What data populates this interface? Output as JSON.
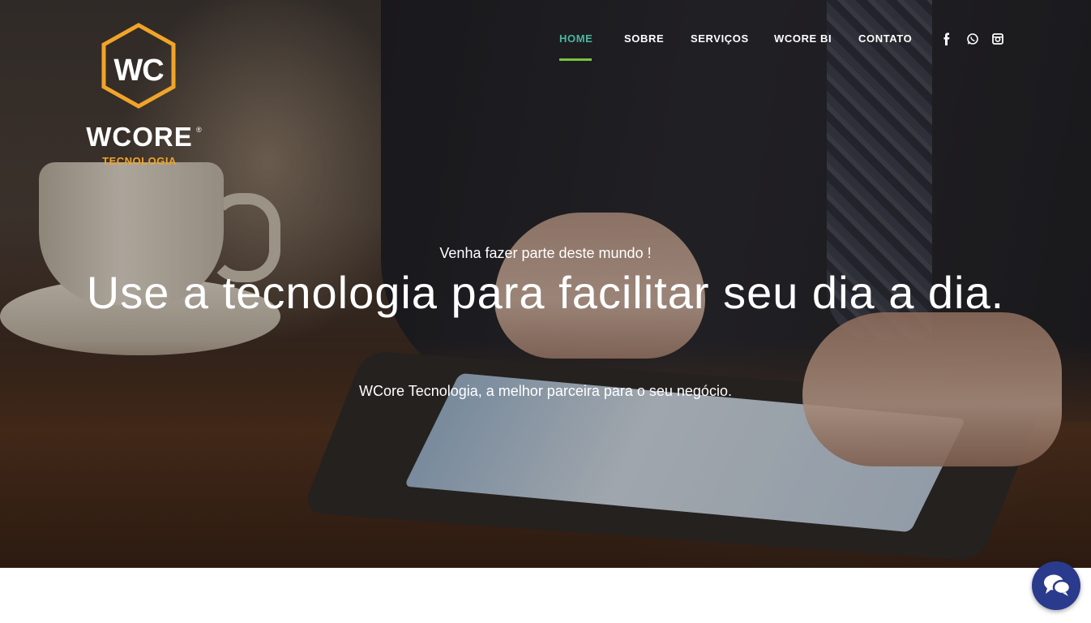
{
  "brand": {
    "monogram": "WC",
    "name": "WCORE",
    "registered": "®",
    "subtitle": "TECNOLOGIA",
    "accent_color": "#f0a428"
  },
  "nav": {
    "items": [
      {
        "label": "HOME",
        "active": true
      },
      {
        "label": "SOBRE",
        "active": false
      },
      {
        "label": "SERVIÇOS",
        "active": false
      },
      {
        "label": "WCORE BI",
        "active": false
      },
      {
        "label": "CONTATO",
        "active": false
      }
    ],
    "active_color": "#49b8a0",
    "underline_color": "#7cc142",
    "social": [
      {
        "icon": "facebook-icon",
        "glyph": "f"
      },
      {
        "icon": "whatsapp-icon",
        "glyph": "◎"
      },
      {
        "icon": "instagram-icon",
        "glyph": "▣"
      }
    ]
  },
  "hero": {
    "kicker": "Venha fazer parte deste mundo !",
    "title": "Use a tecnologia para facilitar seu dia a dia.",
    "tagline": "WCore Tecnologia, a melhor parceira para o seu negócio."
  },
  "chat": {
    "icon": "chat-bubbles-icon",
    "color": "#2a3a8c"
  }
}
